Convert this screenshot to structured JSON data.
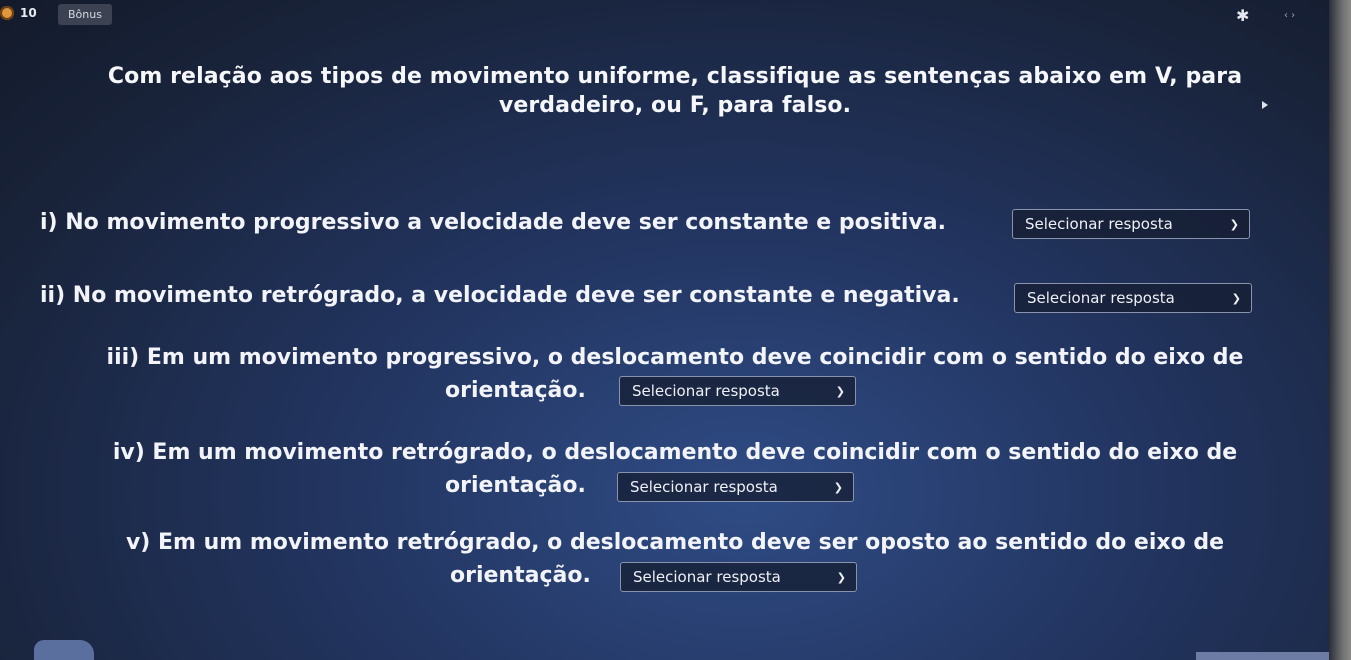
{
  "header": {
    "question_number": "10",
    "bonus_label": "Bônus",
    "gear_icon": "gear-icon",
    "expand_icon": "expand-icon"
  },
  "question": {
    "title": "Com relação aos tipos de movimento uniforme, classifique as sentenças abaixo em V, para verdadeiro, ou F, para falso."
  },
  "items": [
    {
      "line1": "i) No movimento progressivo a velocidade deve ser constante e positiva.",
      "line2": "",
      "select_value": "Selecionar resposta"
    },
    {
      "line1": "ii) No movimento retrógrado, a velocidade deve ser constante e negativa.",
      "line2": "",
      "select_value": "Selecionar resposta"
    },
    {
      "line1": "iii) Em um movimento progressivo, o deslocamento deve coincidir com o sentido do eixo de",
      "line2": "orientação.",
      "select_value": "Selecionar resposta"
    },
    {
      "line1": "iv) Em um movimento retrógrado, o deslocamento deve coincidir com o sentido do eixo de",
      "line2": "orientação.",
      "select_value": "Selecionar resposta"
    },
    {
      "line1": "v) Em um movimento retrógrado, o deslocamento deve ser oposto ao sentido do eixo de",
      "line2": "orientação.",
      "select_value": "Selecionar resposta"
    }
  ],
  "colors": {
    "background": "#22345f",
    "text": "#f4f6fb",
    "select_border": "#8a93ad",
    "status_dot": "#e0963a"
  }
}
